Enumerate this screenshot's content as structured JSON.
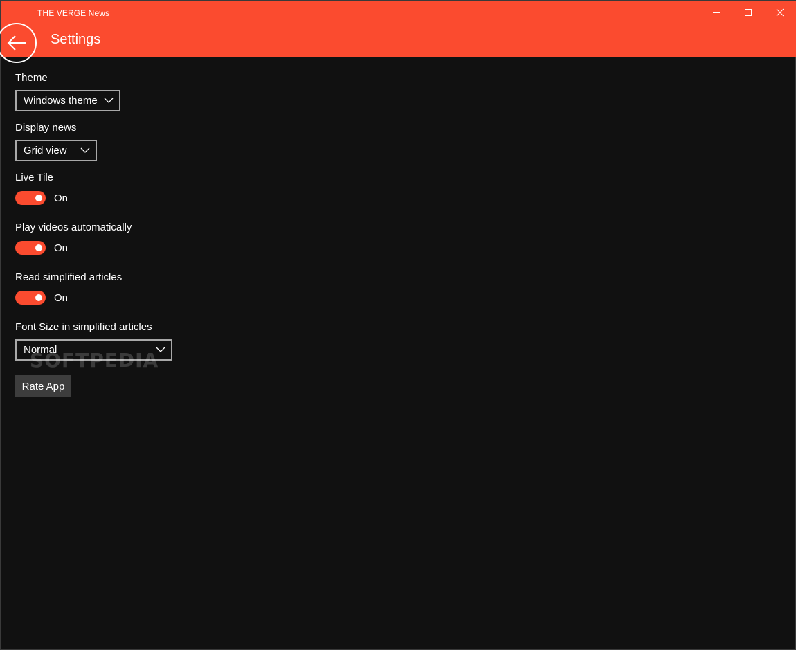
{
  "window": {
    "app_title": "THE VERGE News",
    "controls": {
      "minimize_icon": "minimize-icon",
      "maximize_icon": "maximize-icon",
      "close_icon": "close-icon"
    }
  },
  "header": {
    "title": "Settings",
    "back_icon": "back-arrow-icon",
    "accent_color": "#fb4b2f"
  },
  "settings": {
    "theme": {
      "label": "Theme",
      "value": "Windows theme"
    },
    "display_news": {
      "label": "Display news",
      "value": "Grid view"
    },
    "live_tile": {
      "label": "Live Tile",
      "state": "On"
    },
    "play_videos": {
      "label": "Play videos automatically",
      "state": "On"
    },
    "simplified_articles": {
      "label": "Read simplified articles",
      "state": "On"
    },
    "font_size": {
      "label": "Font Size in simplified articles",
      "value": "Normal"
    },
    "rate_button": "Rate App"
  },
  "watermark": "SOFTPEDIA"
}
